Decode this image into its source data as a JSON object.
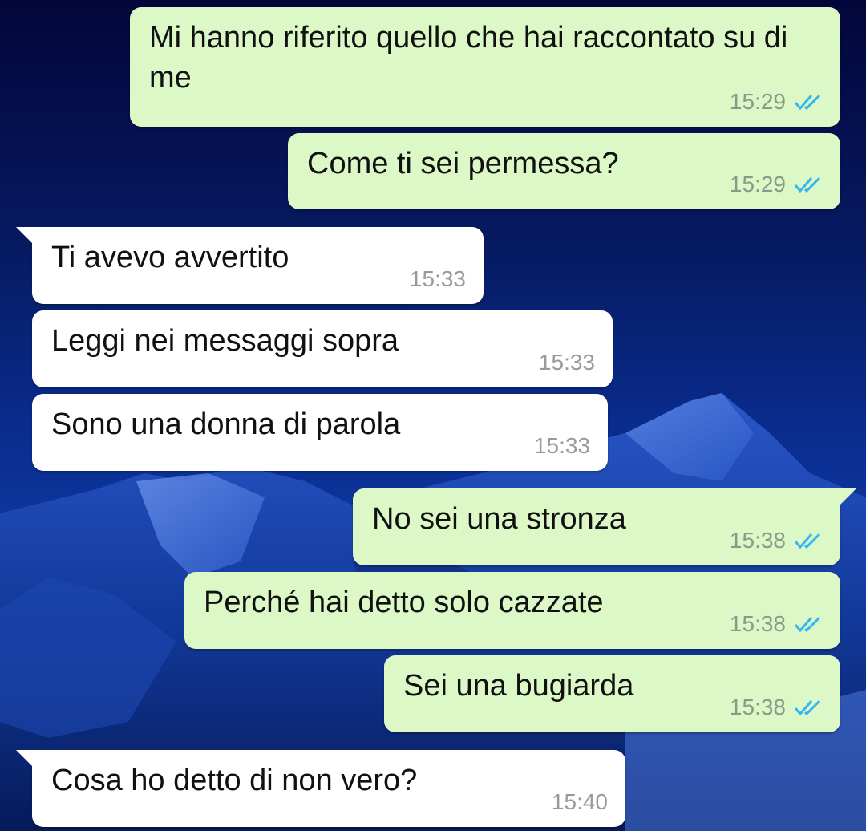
{
  "colors": {
    "outgoing_bubble": "#dcf8c6",
    "incoming_bubble": "#ffffff",
    "read_tick": "#34b7f1",
    "wallpaper": "#0a2f94"
  },
  "messages": [
    {
      "direction": "outgoing",
      "text": "Mi hanno riferito quello che hai raccontato su di me",
      "time": "15:29",
      "status": "read-double-tick-icon"
    },
    {
      "direction": "outgoing",
      "text": "Come ti sei permessa?",
      "time": "15:29",
      "status": "read-double-tick-icon"
    },
    {
      "direction": "incoming",
      "text": "Ti avevo avvertito",
      "time": "15:33"
    },
    {
      "direction": "incoming",
      "text": "Leggi nei messaggi sopra",
      "time": "15:33"
    },
    {
      "direction": "incoming",
      "text": "Sono una donna di parola",
      "time": "15:33"
    },
    {
      "direction": "outgoing",
      "text": "No sei una stronza",
      "time": "15:38",
      "status": "read-double-tick-icon"
    },
    {
      "direction": "outgoing",
      "text": "Perché hai detto solo cazzate",
      "time": "15:38",
      "status": "read-double-tick-icon"
    },
    {
      "direction": "outgoing",
      "text": "Sei una bugiarda",
      "time": "15:38",
      "status": "read-double-tick-icon"
    },
    {
      "direction": "incoming",
      "text": "Cosa ho detto di non vero?",
      "time": "15:40"
    }
  ]
}
